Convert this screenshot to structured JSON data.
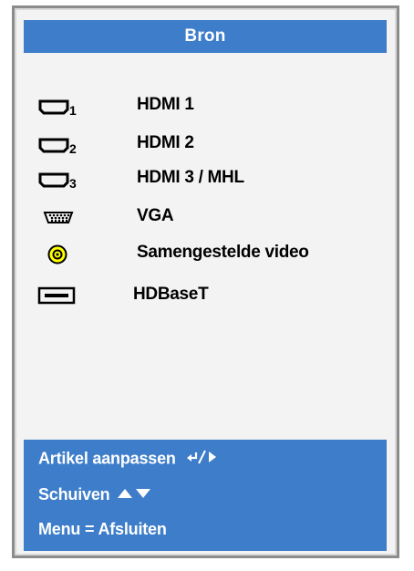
{
  "menu": {
    "title": "Bron",
    "items": [
      {
        "label": "HDMI 1",
        "icon": "hdmi-port-icon",
        "subscript": "1"
      },
      {
        "label": "HDMI 2",
        "icon": "hdmi-port-icon",
        "subscript": "2"
      },
      {
        "label": "HDMI 3 / MHL",
        "icon": "hdmi-port-icon",
        "subscript": "3"
      },
      {
        "label": "VGA",
        "icon": "vga-port-icon"
      },
      {
        "label": "Samengestelde video",
        "icon": "composite-video-icon"
      },
      {
        "label": "HDBaseT",
        "icon": "hdbaset-port-icon"
      }
    ]
  },
  "footer": {
    "adjust": "Artikel aanpassen",
    "scroll": "Schuiven",
    "exit": "Menu = Afsluiten"
  },
  "colors": {
    "panel_blue": "#3d7dca",
    "background": "#f3f3f3",
    "composite_yellow": "#ffff00"
  }
}
